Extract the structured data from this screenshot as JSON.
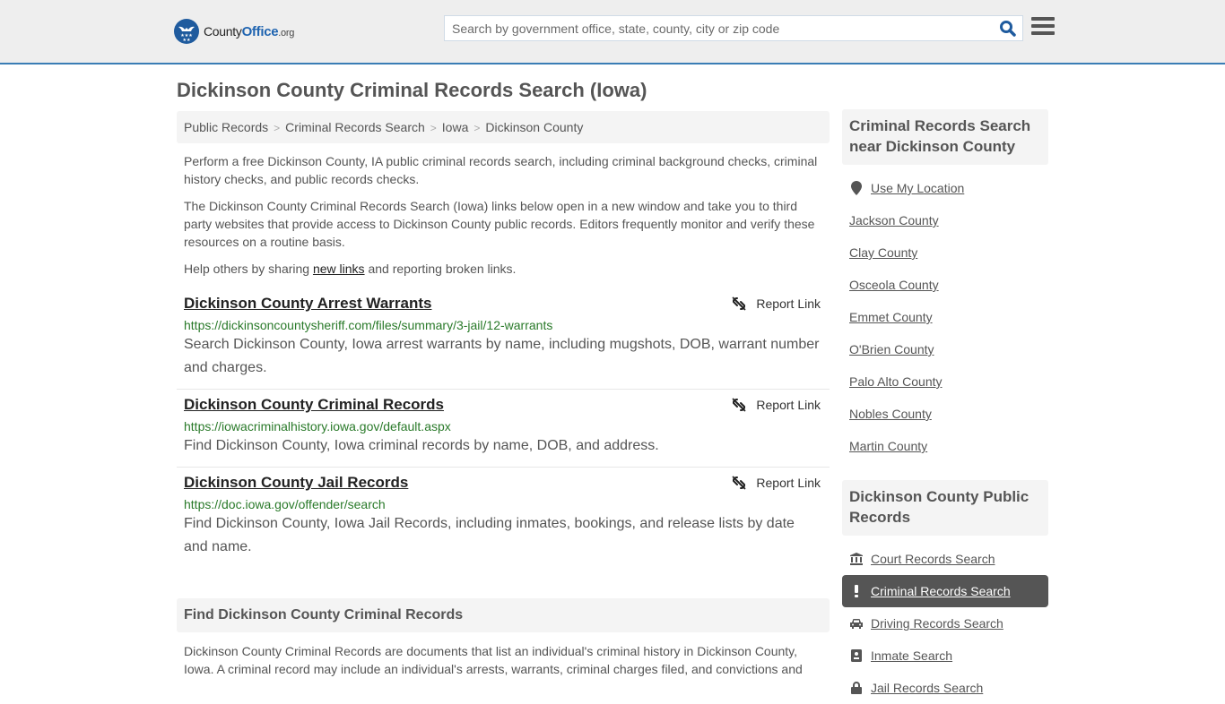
{
  "header": {
    "logo": {
      "prefix": "County",
      "brand": "Office",
      "suffix": ".org"
    },
    "search_placeholder": "Search by government office, state, county, city or zip code",
    "search_value": ""
  },
  "page_title": "Dickinson County Criminal Records Search (Iowa)",
  "breadcrumb": [
    {
      "label": "Public Records"
    },
    {
      "label": "Criminal Records Search"
    },
    {
      "label": "Iowa"
    },
    {
      "label": "Dickinson County"
    }
  ],
  "breadcrumb_separator": ">",
  "intro": {
    "p1": "Perform a free Dickinson County, IA public criminal records search, including criminal background checks, criminal history checks, and public records checks.",
    "p2": "The Dickinson County Criminal Records Search (Iowa) links below open in a new window and take you to third party websites that provide access to Dickinson County public records. Editors frequently monitor and verify these resources on a routine basis.",
    "p3_before": "Help others by sharing ",
    "p3_link": "new links",
    "p3_after": " and reporting broken links."
  },
  "report_label": "Report Link",
  "links": [
    {
      "title": "Dickinson County Arrest Warrants",
      "url": "https://dickinsoncountysheriff.com/files/summary/3-jail/12-warrants",
      "description": "Search Dickinson County, Iowa arrest warrants by name, including mugshots, DOB, warrant number and charges."
    },
    {
      "title": "Dickinson County Criminal Records",
      "url": "https://iowacriminalhistory.iowa.gov/default.aspx",
      "description": "Find Dickinson County, Iowa criminal records by name, DOB, and address."
    },
    {
      "title": "Dickinson County Jail Records",
      "url": "https://doc.iowa.gov/offender/search",
      "description": "Find Dickinson County, Iowa Jail Records, including inmates, bookings, and release lists by date and name."
    }
  ],
  "find_section": {
    "heading": "Find Dickinson County Criminal Records",
    "body": "Dickinson County Criminal Records are documents that list an individual's criminal history in Dickinson County, Iowa. A criminal record may include an individual's arrests, warrants, criminal charges filed, and convictions and"
  },
  "sidebar": {
    "nearby": {
      "heading": "Criminal Records Search near Dickinson County",
      "use_location": "Use My Location",
      "counties": [
        "Jackson County",
        "Clay County",
        "Osceola County",
        "Emmet County",
        "O'Brien County",
        "Palo Alto County",
        "Nobles County",
        "Martin County"
      ]
    },
    "public_records": {
      "heading": "Dickinson County Public Records",
      "items": [
        {
          "label": "Court Records Search",
          "icon": "courthouse-icon",
          "active": false
        },
        {
          "label": "Criminal Records Search",
          "icon": "exclamation-icon",
          "active": true
        },
        {
          "label": "Driving Records Search",
          "icon": "car-icon",
          "active": false
        },
        {
          "label": "Inmate Search",
          "icon": "id-badge-icon",
          "active": false
        },
        {
          "label": "Jail Records Search",
          "icon": "lock-icon",
          "active": false
        }
      ]
    }
  },
  "colors": {
    "header_border": "#3a7db5",
    "brand_blue": "#1f5b9e",
    "url_green": "#2a7a2a",
    "active_bg": "#555555"
  }
}
